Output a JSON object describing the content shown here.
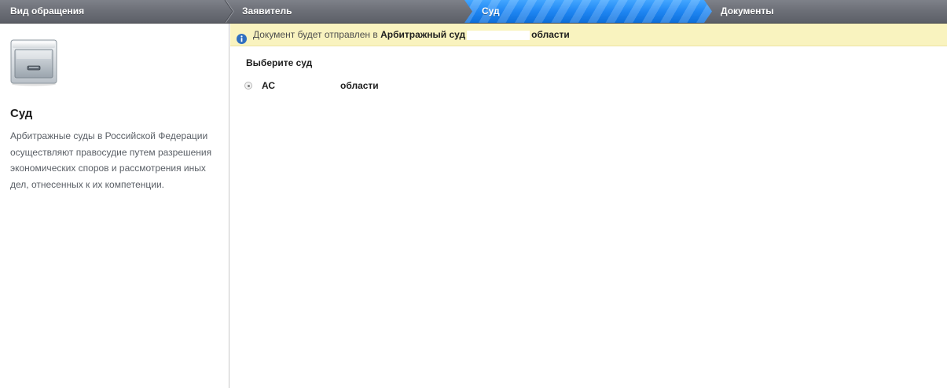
{
  "wizard": {
    "steps": [
      {
        "label": "Вид обращения",
        "state": "completed"
      },
      {
        "label": "Заявитель",
        "state": "completed"
      },
      {
        "label": "Суд",
        "state": "active"
      },
      {
        "label": "Документы",
        "state": "pending"
      }
    ],
    "colors": {
      "bar": "#6b6e76",
      "active": "#1f86f2"
    }
  },
  "left": {
    "icon": "file-cabinet-icon",
    "title": "Суд",
    "description": "Арбитражные суды в Российской Федерации осуществляют правосудие путем разрешения экономических споров и рассмотрения иных дел, отнесенных к их компетенции."
  },
  "info": {
    "icon": "info-icon",
    "prefix": "Документ будет отправлен в",
    "court_prefix": "Арбитражный суд",
    "court_suffix": "области",
    "background": "#f9f3bf"
  },
  "court_select": {
    "label": "Выберите суд",
    "options": [
      {
        "label_start": "АС",
        "label_end": "области",
        "selected": true
      }
    ]
  }
}
